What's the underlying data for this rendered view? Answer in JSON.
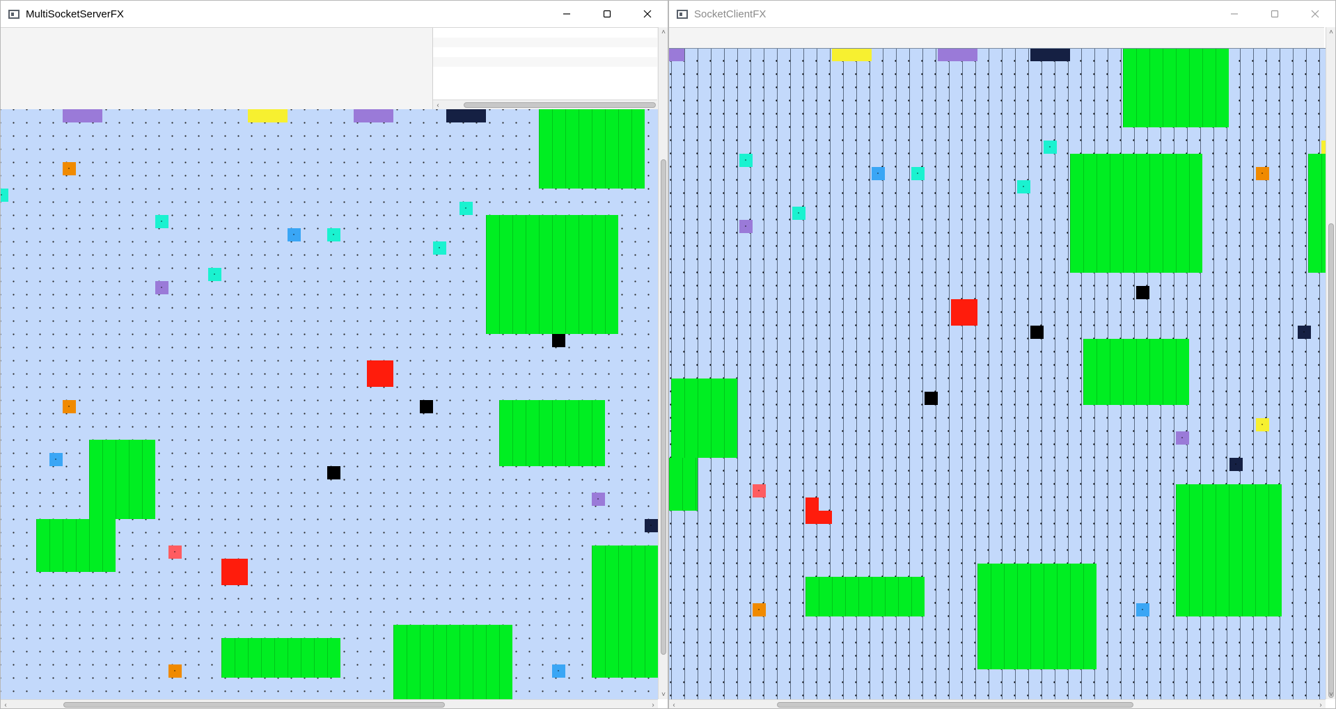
{
  "colors": {
    "board_bg": "#c3d9fb",
    "wall_green": "#00ee22",
    "player_red": "#ff1c0c",
    "purple": "#9a7ad8",
    "yellow": "#f7f030",
    "navy": "#152043",
    "orange": "#f08a00",
    "cyan": "#1af2d0",
    "blue": "#3aa6f5",
    "black": "#000000",
    "salmon": "#ff5c60"
  },
  "server_window": {
    "title": "MultiSocketServerFX",
    "icons": [
      "app-icon",
      "minimize-icon",
      "maximize-icon",
      "close-icon"
    ]
  },
  "client_window": {
    "title": "SocketClientFX",
    "icons": [
      "app-icon",
      "minimize-icon",
      "maximize-icon",
      "close-icon"
    ]
  }
}
